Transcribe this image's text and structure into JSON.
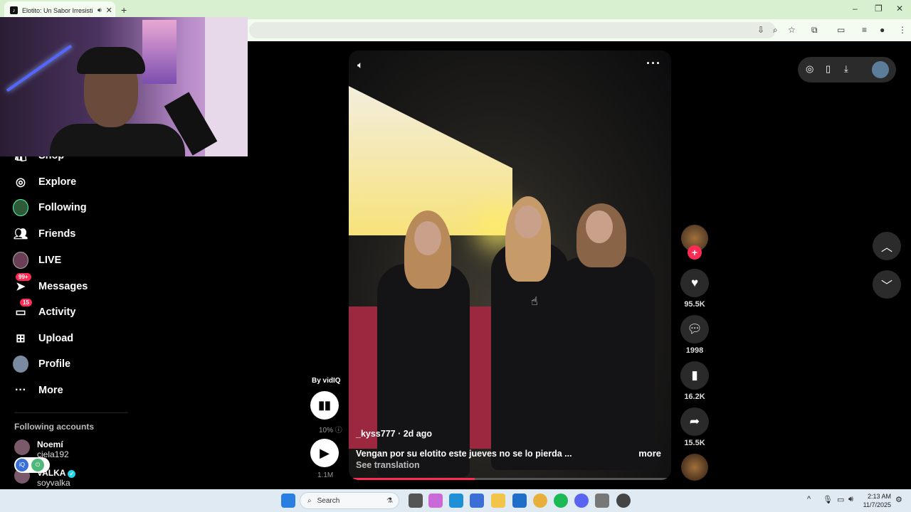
{
  "browser": {
    "tab_title": "Elotito: Un Sabor Irresistible",
    "tab_favicon": "tiktok-icon",
    "new_tab": "+",
    "close": "✕"
  },
  "sidebar": {
    "items": [
      {
        "label": "Shop",
        "icon": "shop-icon"
      },
      {
        "label": "Explore",
        "icon": "compass-icon"
      },
      {
        "label": "Following",
        "icon": "following-avatar-icon"
      },
      {
        "label": "Friends",
        "icon": "friends-icon"
      },
      {
        "label": "LIVE",
        "icon": "live-icon"
      },
      {
        "label": "Messages",
        "icon": "messages-icon",
        "badge": "99+"
      },
      {
        "label": "Activity",
        "icon": "activity-icon",
        "badge": "15"
      },
      {
        "label": "Upload",
        "icon": "upload-icon"
      },
      {
        "label": "Profile",
        "icon": "profile-avatar-icon"
      },
      {
        "label": "More",
        "icon": "more-icon"
      }
    ],
    "following_title": "Following accounts",
    "accounts": [
      {
        "name": "Noemí",
        "handle": "ciela192"
      },
      {
        "name": "VALKA",
        "handle": "soyvalka"
      }
    ]
  },
  "video": {
    "author": "_kyss777 · 2d ago",
    "description": "Vengan por su elotito este jueves no se lo pierda ...",
    "see_translation": "See translation",
    "more": "more",
    "progress": 0.39
  },
  "vidiq": {
    "by_label": "By vidIQ",
    "percent": "10%",
    "views": "1.1M"
  },
  "actions": {
    "likes": "95.5K",
    "comments": "1998",
    "saves": "16.2K",
    "shares": "15.5K"
  },
  "taskbar": {
    "search_label": "Search",
    "time": "2:13 AM",
    "date": "11/7/2025"
  },
  "colors": {
    "accent": "#fe2c55",
    "background": "#000000"
  }
}
